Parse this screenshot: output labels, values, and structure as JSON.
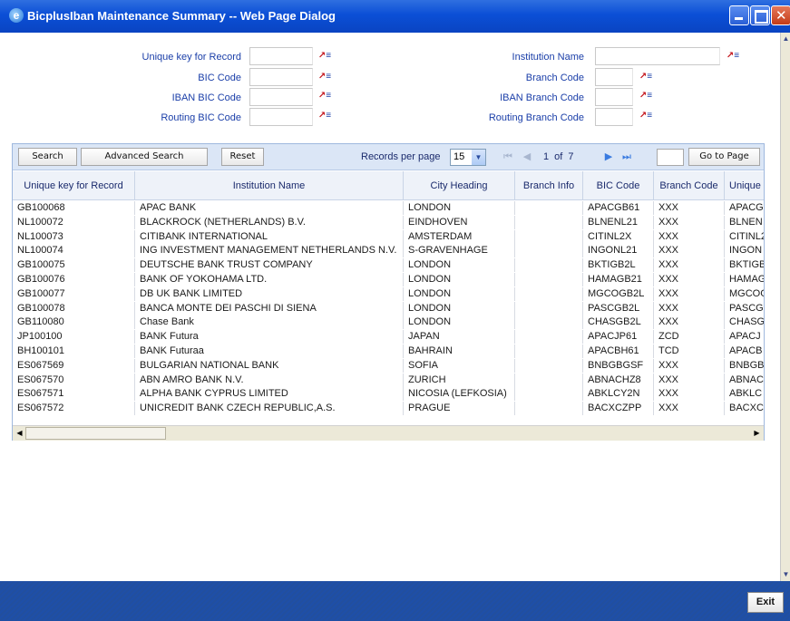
{
  "window": {
    "title": "BicplusIban Maintenance Summary -- Web Page Dialog",
    "icon": "ie-icon"
  },
  "form": {
    "unique_key_label": "Unique key for Record",
    "bic_code_label": "BIC Code",
    "iban_bic_code_label": "IBAN BIC Code",
    "routing_bic_code_label": "Routing BIC Code",
    "institution_name_label": "Institution Name",
    "branch_code_label": "Branch Code",
    "iban_branch_code_label": "IBAN Branch Code",
    "routing_branch_code_label": "Routing Branch Code"
  },
  "toolbar": {
    "search": "Search",
    "advanced_search": "Advanced Search",
    "reset": "Reset",
    "records_per_page": "Records per page",
    "records_per_page_value": "15",
    "page_info": "1  of  7",
    "go_to_page": "Go to Page"
  },
  "table": {
    "headers": [
      "Unique key for Record",
      "Institution Name",
      "City Heading",
      "Branch Info",
      "BIC Code",
      "Branch Code",
      "Unique"
    ],
    "rows": [
      [
        "GB100068",
        "APAC BANK",
        "LONDON",
        "",
        "APACGB61",
        "XXX",
        "APACG"
      ],
      [
        "NL100072",
        "BLACKROCK (NETHERLANDS) B.V.",
        "EINDHOVEN",
        "",
        "BLNENL21",
        "XXX",
        "BLNEN"
      ],
      [
        "NL100073",
        "CITIBANK INTERNATIONAL",
        "AMSTERDAM",
        "",
        "CITINL2X",
        "XXX",
        "CITINL2"
      ],
      [
        "NL100074",
        "ING INVESTMENT MANAGEMENT NETHERLANDS N.V.",
        "S-GRAVENHAGE",
        "",
        "INGONL21",
        "XXX",
        "INGON"
      ],
      [
        "GB100075",
        "DEUTSCHE BANK TRUST COMPANY",
        "LONDON",
        "",
        "BKTIGB2L",
        "XXX",
        "BKTIGB"
      ],
      [
        "GB100076",
        "BANK OF YOKOHAMA LTD.",
        "LONDON",
        "",
        "HAMAGB21",
        "XXX",
        "HAMAG"
      ],
      [
        "GB100077",
        "DB UK BANK LIMITED",
        "LONDON",
        "",
        "MGCOGB2L",
        "XXX",
        "MGCOG"
      ],
      [
        "GB100078",
        "BANCA MONTE DEI PASCHI DI SIENA",
        "LONDON",
        "",
        "PASCGB2L",
        "XXX",
        "PASCG"
      ],
      [
        "GB110080",
        "Chase Bank",
        "LONDON",
        "",
        "CHASGB2L",
        "XXX",
        "CHASG"
      ],
      [
        "JP100100",
        "BANK Futura",
        "JAPAN",
        "",
        "APACJP61",
        "ZCD",
        "APACJ"
      ],
      [
        "BH100101",
        "BANK Futuraa",
        "BAHRAIN",
        "",
        "APACBH61",
        "TCD",
        "APACB"
      ],
      [
        "ES067569",
        "BULGARIAN NATIONAL BANK",
        "SOFIA",
        "",
        "BNBGBGSF",
        "XXX",
        "BNBGB"
      ],
      [
        "ES067570",
        "ABN AMRO BANK N.V.",
        "ZURICH",
        "",
        "ABNACHZ8",
        "XXX",
        "ABNAC"
      ],
      [
        "ES067571",
        "ALPHA BANK CYPRUS LIMITED",
        "NICOSIA (LEFKOSIA)",
        "",
        "ABKLCY2N",
        "XXX",
        "ABKLC"
      ],
      [
        "ES067572",
        "UNICREDIT BANK CZECH REPUBLIC,A.S.",
        "PRAGUE",
        "",
        "BACXCZPP",
        "XXX",
        "BACXC"
      ]
    ]
  },
  "footer": {
    "exit": "Exit"
  }
}
